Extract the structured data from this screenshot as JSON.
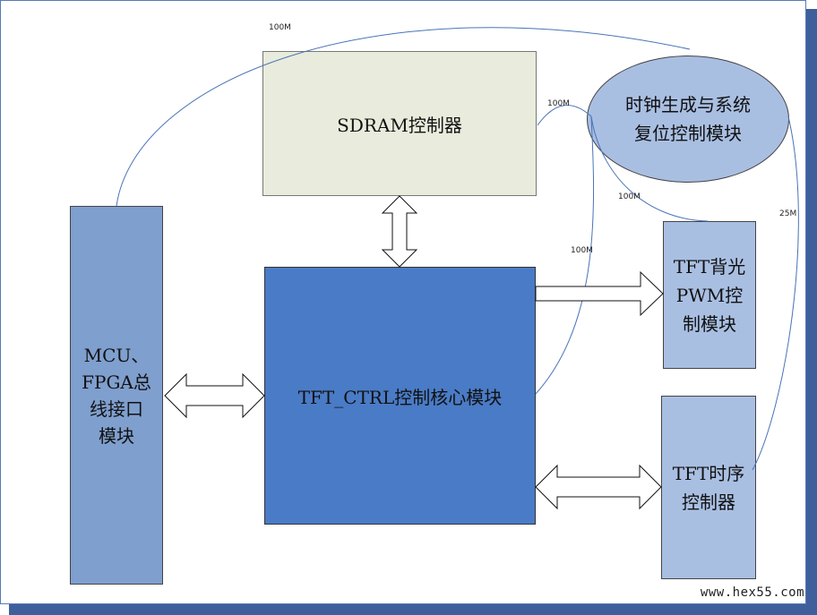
{
  "blocks": {
    "sdram": "SDRAM控制器",
    "core": "TFT_CTRL控制核心模块",
    "mcu": "MCU、\nFPGA总\n线接口\n模块",
    "pwm": "TFT背光\nPWM控\n制模块",
    "timing": "TFT时序\n控制器",
    "clock": "时钟生成与系统\n复位控制模块"
  },
  "edges": {
    "to_mcu": "100M",
    "to_sdram": "100M",
    "to_pwm": "100M",
    "to_core": "100M",
    "to_timing": "25M"
  },
  "colors": {
    "core": "#4a7bc6",
    "side_blocks": "#a9bfe2",
    "mcu": "#7f9fce",
    "sdram": "#e9ebdc",
    "clock_lines": "#4a74b8"
  },
  "watermark": "www.hex55.com"
}
